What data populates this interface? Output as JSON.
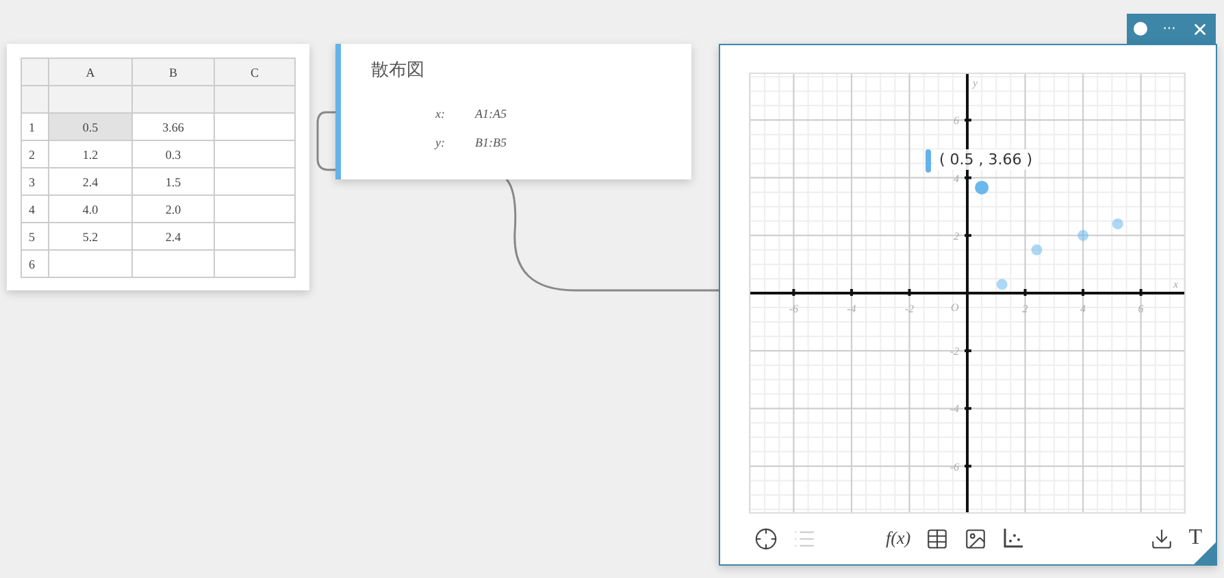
{
  "spreadsheet": {
    "columns": [
      "A",
      "B",
      "C"
    ],
    "rows": [
      {
        "label": "1",
        "cells": [
          {
            "value": "0.5",
            "selected": true
          },
          {
            "value": "3.66",
            "selected": false
          },
          {
            "selected": false
          }
        ]
      },
      {
        "label": "2",
        "cells": [
          {
            "value": "1.2",
            "selected": false
          },
          {
            "value": "0.3",
            "selected": false
          },
          {
            "selected": false
          }
        ]
      },
      {
        "label": "3",
        "cells": [
          {
            "value": "2.4",
            "selected": false
          },
          {
            "value": "1.5",
            "selected": false
          },
          {
            "selected": false
          }
        ]
      },
      {
        "label": "4",
        "cells": [
          {
            "value": "4.0",
            "selected": false
          },
          {
            "value": "2.0",
            "selected": false
          },
          {
            "selected": false
          }
        ]
      },
      {
        "label": "5",
        "cells": [
          {
            "value": "5.2",
            "selected": false
          },
          {
            "value": "2.4",
            "selected": false
          },
          {
            "selected": false
          }
        ]
      },
      {
        "label": "6",
        "cells": [
          {
            "selected": false
          },
          {
            "selected": false
          },
          {
            "selected": false
          }
        ]
      }
    ]
  },
  "connection_card": {
    "title": "散布図",
    "fields": [
      {
        "label": "x:",
        "value": "A1:A5"
      },
      {
        "label": "y:",
        "value": "B1:B5"
      }
    ]
  },
  "graph_window": {
    "title_bar": {
      "more": "···"
    },
    "plot": {
      "chart_data": {
        "type": "scatter",
        "xlabel": "x",
        "ylabel": "y",
        "grid": true,
        "xlim": [
          -7.5,
          7.5
        ],
        "ylim": [
          -7.6,
          7.6
        ],
        "xticks": [
          -6,
          -4,
          -2,
          2,
          4,
          6
        ],
        "yticks": [
          -6,
          -4,
          -2,
          2,
          4,
          6
        ],
        "x": [
          0.5,
          1.2,
          2.4,
          4.0,
          5.2
        ],
        "series": [
          {
            "color": "#6ab8ec",
            "values": [
              3.66,
              0.3,
              1.5,
              2.0,
              2.4
            ]
          }
        ]
      },
      "point_states": [
        {
          "selected": true
        },
        {
          "selected": false
        },
        {
          "selected": false
        },
        {
          "selected": false
        },
        {
          "selected": false
        }
      ],
      "origin_label": "O",
      "tooltip": "( 0.5 , 3.66 )"
    },
    "toolbar": [
      {
        "kind": "crosshair",
        "disabled": false
      },
      {
        "kind": "list",
        "disabled": true
      },
      {
        "kind": "function",
        "text": "f(x)",
        "disabled": false
      },
      {
        "kind": "table",
        "disabled": false
      },
      {
        "kind": "image",
        "disabled": false
      },
      {
        "kind": "scatter",
        "disabled": false
      },
      {
        "kind": "spacer"
      },
      {
        "kind": "download",
        "disabled": false
      },
      {
        "kind": "text",
        "text": "T",
        "disabled": false
      }
    ]
  }
}
